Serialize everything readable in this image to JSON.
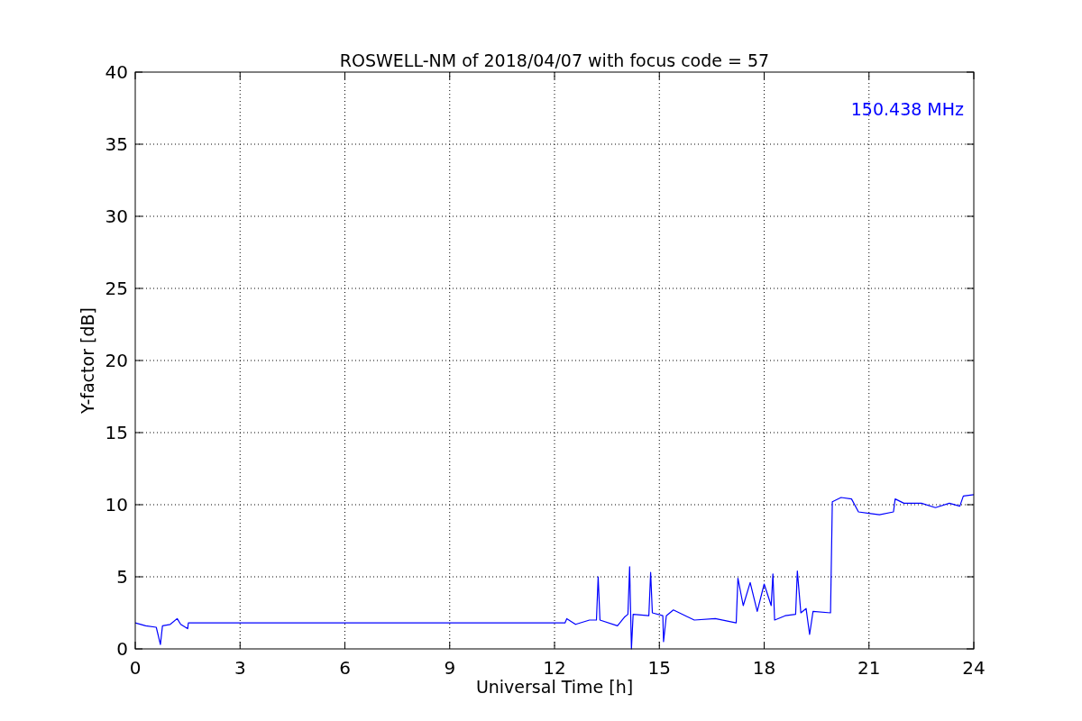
{
  "chart_data": {
    "type": "line",
    "title": "ROSWELL-NM of 2018/04/07 with focus code = 57",
    "xlabel": "Universal Time [h]",
    "ylabel": "Y-factor [dB]",
    "xlim": [
      0,
      24
    ],
    "ylim": [
      0,
      40
    ],
    "xticks": [
      0,
      3,
      6,
      9,
      12,
      15,
      18,
      21,
      24
    ],
    "yticks": [
      0,
      5,
      10,
      15,
      20,
      25,
      30,
      35,
      40
    ],
    "x": [
      0,
      0.3,
      0.6,
      0.72,
      0.78,
      1.0,
      1.2,
      1.3,
      1.5,
      1.52,
      12.3,
      12.35,
      12.6,
      13.0,
      13.2,
      13.25,
      13.3,
      13.8,
      14.0,
      14.1,
      14.15,
      14.2,
      14.25,
      14.7,
      14.75,
      14.8,
      15.1,
      15.12,
      15.2,
      15.4,
      16.0,
      16.6,
      17.2,
      17.25,
      17.4,
      17.6,
      17.8,
      18.0,
      18.2,
      18.25,
      18.3,
      18.6,
      18.9,
      18.95,
      19.05,
      19.2,
      19.3,
      19.4,
      19.9,
      19.95,
      20.2,
      20.5,
      20.7,
      21.0,
      21.3,
      21.7,
      21.75,
      22.0,
      22.5,
      22.9,
      23.3,
      23.6,
      23.7,
      24.0
    ],
    "series": [
      {
        "name": "150.438 MHz",
        "color": "#0000ff",
        "values": [
          1.8,
          1.6,
          1.5,
          0.3,
          1.6,
          1.7,
          2.1,
          1.7,
          1.4,
          1.8,
          1.8,
          2.1,
          1.7,
          2.0,
          2.0,
          5.0,
          2.0,
          1.6,
          2.2,
          2.4,
          5.7,
          0.0,
          2.4,
          2.3,
          5.3,
          2.5,
          2.3,
          0.5,
          2.3,
          2.7,
          2.0,
          2.1,
          1.8,
          4.9,
          3.0,
          4.6,
          2.6,
          4.5,
          3.0,
          5.2,
          2.0,
          2.3,
          2.4,
          5.4,
          2.5,
          2.8,
          1.0,
          2.6,
          2.5,
          10.2,
          10.5,
          10.4,
          9.5,
          9.4,
          9.3,
          9.5,
          10.4,
          10.1,
          10.1,
          9.8,
          10.1,
          9.9,
          10.6,
          10.7
        ]
      }
    ],
    "grid": true
  }
}
